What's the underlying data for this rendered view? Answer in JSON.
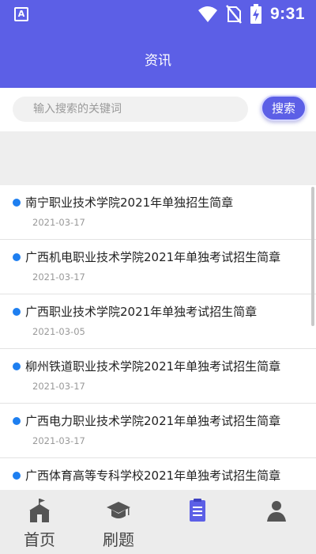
{
  "status_bar": {
    "app_icon_letter": "A",
    "time": "9:31",
    "icons": [
      "wifi-icon",
      "no-sim-icon",
      "battery-charging-icon"
    ]
  },
  "header": {
    "title": "资讯"
  },
  "search": {
    "placeholder": "输入搜索的关键词",
    "button_label": "搜索",
    "icon": "search-icon"
  },
  "news": [
    {
      "title": "南宁职业技术学院2021年单独招生简章",
      "date": "2021-03-17"
    },
    {
      "title": "广西机电职业技术学院2021年单独考试招生简章",
      "date": "2021-03-17"
    },
    {
      "title": "广西职业技术学院2021年单独考试招生简章",
      "date": "2021-03-05"
    },
    {
      "title": "柳州铁道职业技术学院2021年单独考试招生简章",
      "date": "2021-03-17"
    },
    {
      "title": "广西电力职业技术学院2021年单独考试招生简章",
      "date": "2021-03-17"
    },
    {
      "title": "广西体育高等专科学校2021年单独考试招生简章",
      "date": ""
    }
  ],
  "tabs": [
    {
      "label": "首页",
      "icon": "school-building-icon"
    },
    {
      "label": "刷题",
      "icon": "graduation-cap-icon"
    },
    {
      "label": "",
      "icon": "document-list-icon"
    },
    {
      "label": "",
      "icon": "user-profile-icon"
    }
  ],
  "colors": {
    "primary": "#5c5fe6",
    "dot": "#1e7ff0",
    "tab_bar": "#ececec"
  }
}
